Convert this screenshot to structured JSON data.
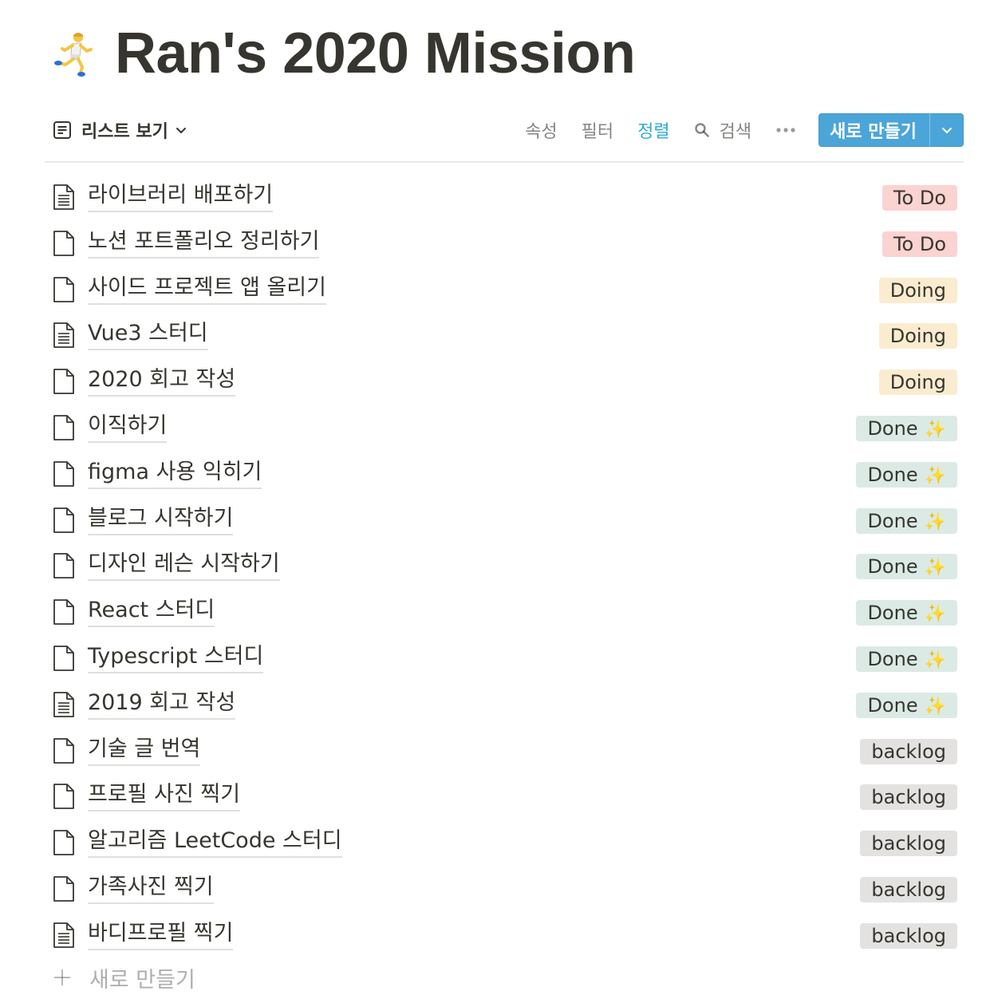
{
  "page": {
    "title": "Ran's 2020 Mission",
    "title_icon": "runner-emoji"
  },
  "toolbar": {
    "view_label": "리스트 보기",
    "properties_label": "속성",
    "filter_label": "필터",
    "sort_label": "정렬",
    "search_label": "검색",
    "new_button_label": "새로 만들기",
    "accent_color": "#2eaadc",
    "button_color": "#4ba5d8"
  },
  "items": [
    {
      "title": "라이브러리 배포하기",
      "status": "To Do",
      "icon": "page-with-text-icon"
    },
    {
      "title": "노션 포트폴리오 정리하기",
      "status": "To Do",
      "icon": "empty-page-icon"
    },
    {
      "title": "사이드 프로젝트 앱 올리기",
      "status": "Doing",
      "icon": "empty-page-icon"
    },
    {
      "title": "Vue3 스터디",
      "status": "Doing",
      "icon": "page-with-text-icon"
    },
    {
      "title": "2020 회고 작성",
      "status": "Doing",
      "icon": "empty-page-icon"
    },
    {
      "title": "이직하기",
      "status": "Done",
      "icon": "empty-page-icon"
    },
    {
      "title": "figma 사용 익히기",
      "status": "Done",
      "icon": "empty-page-icon"
    },
    {
      "title": "블로그 시작하기",
      "status": "Done",
      "icon": "empty-page-icon"
    },
    {
      "title": "디자인 레슨 시작하기",
      "status": "Done",
      "icon": "empty-page-icon"
    },
    {
      "title": "React 스터디",
      "status": "Done",
      "icon": "empty-page-icon"
    },
    {
      "title": "Typescript 스터디",
      "status": "Done",
      "icon": "empty-page-icon"
    },
    {
      "title": "2019 회고 작성",
      "status": "Done",
      "icon": "page-with-text-icon"
    },
    {
      "title": "기술 글 번역",
      "status": "backlog",
      "icon": "empty-page-icon"
    },
    {
      "title": "프로필 사진 찍기",
      "status": "backlog",
      "icon": "empty-page-icon"
    },
    {
      "title": "알고리즘 LeetCode 스터디",
      "status": "backlog",
      "icon": "empty-page-icon"
    },
    {
      "title": "가족사진 찍기",
      "status": "backlog",
      "icon": "empty-page-icon"
    },
    {
      "title": "바디프로필 찍기",
      "status": "backlog",
      "icon": "page-with-text-icon"
    }
  ],
  "status_colors": {
    "To Do": "#fbd3d1",
    "Doing": "#fbecd0",
    "Done": "#dbeae4",
    "backlog": "#e3e2e0"
  },
  "done_suffix_icon": "sparkles-icon",
  "add_row": {
    "label": "새로 만들기"
  }
}
